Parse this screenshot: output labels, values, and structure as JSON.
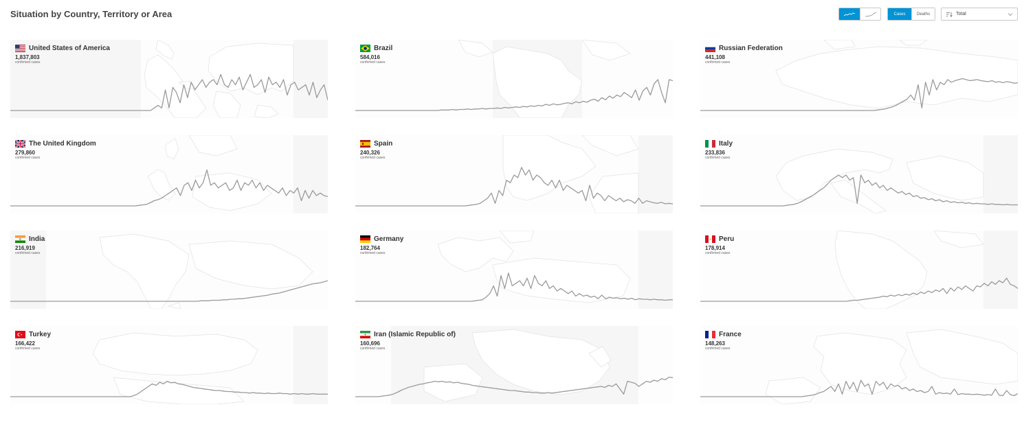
{
  "page": {
    "title": "Situation by Country, Territory or Area"
  },
  "controls": {
    "metric_tabs": [
      {
        "label": "Cases",
        "active": true
      },
      {
        "label": "Deaths",
        "active": false
      }
    ],
    "select": {
      "value": "Total"
    },
    "accent_color": "#0093d5"
  },
  "countries": [
    {
      "name": "United States of America",
      "cases": "1,837,803",
      "sub": "confirmed cases",
      "flag": "us",
      "map": "world",
      "trend": [
        0,
        0,
        0,
        0,
        0,
        0,
        0,
        0,
        0,
        0,
        0,
        0,
        0,
        0,
        0,
        0,
        0,
        0,
        0,
        0,
        0,
        0,
        0,
        0,
        0,
        0,
        0,
        0,
        0,
        0,
        0,
        0,
        0,
        0,
        0,
        0,
        0,
        0,
        0,
        0.05,
        0.1,
        0.05,
        0.4,
        0.05,
        0.45,
        0.35,
        0.15,
        0.5,
        0.25,
        0.55,
        0.4,
        0.5,
        0.6,
        0.45,
        0.55,
        0.6,
        0.5,
        0.7,
        0.5,
        0.45,
        0.6,
        0.5,
        0.65,
        0.4,
        0.55,
        0.7,
        0.45,
        0.5,
        0.6,
        0.35,
        0.65,
        0.5,
        0.55,
        0.45,
        0.6,
        0.3,
        0.5,
        0.55,
        0.4,
        0.45,
        0.5,
        0.3,
        0.55,
        0.25,
        0.4,
        0.5,
        0.2
      ]
    },
    {
      "name": "Brazil",
      "cases": "584,016",
      "sub": "confirmed cases",
      "flag": "br",
      "map": "americas",
      "trend": [
        0,
        0,
        0,
        0,
        0,
        0,
        0,
        0,
        0,
        0,
        0,
        0,
        0,
        0,
        0,
        0,
        0,
        0,
        0,
        0,
        0,
        0,
        0,
        0.01,
        0.01,
        0.01,
        0.02,
        0.01,
        0.02,
        0.02,
        0.03,
        0.02,
        0.03,
        0.03,
        0.04,
        0.03,
        0.04,
        0.04,
        0.05,
        0.04,
        0.06,
        0.05,
        0.06,
        0.07,
        0.06,
        0.08,
        0.07,
        0.09,
        0.08,
        0.1,
        0.09,
        0.12,
        0.1,
        0.13,
        0.11,
        0.12,
        0.14,
        0.15,
        0.13,
        0.17,
        0.15,
        0.18,
        0.16,
        0.2,
        0.22,
        0.18,
        0.25,
        0.21,
        0.28,
        0.24,
        0.3,
        0.27,
        0.35,
        0.3,
        0.25,
        0.4,
        0.2,
        0.38,
        0.45,
        0.3,
        0.52,
        0.6,
        0.35,
        0.15,
        0.6,
        0.58
      ]
    },
    {
      "name": "Russian Federation",
      "cases": "441,108",
      "sub": "confirmed cases",
      "flag": "ru",
      "map": "eurasia",
      "trend": [
        0,
        0,
        0,
        0,
        0,
        0,
        0,
        0,
        0,
        0,
        0,
        0,
        0,
        0,
        0,
        0,
        0,
        0,
        0,
        0,
        0,
        0,
        0,
        0,
        0,
        0,
        0,
        0,
        0,
        0,
        0,
        0,
        0,
        0,
        0,
        0,
        0,
        0,
        0,
        0,
        0,
        0,
        0,
        0,
        0,
        0,
        0,
        0,
        0.01,
        0.02,
        0.03,
        0.05,
        0.07,
        0.1,
        0.14,
        0.18,
        0.22,
        0.3,
        0.2,
        0.5,
        0.05,
        0.55,
        0.3,
        0.6,
        0.4,
        0.55,
        0.5,
        0.6,
        0.55,
        0.58,
        0.6,
        0.62,
        0.6,
        0.58,
        0.59,
        0.6,
        0.58,
        0.57,
        0.56,
        0.58,
        0.55,
        0.56,
        0.54,
        0.56,
        0.55,
        0.53,
        0.54
      ]
    },
    {
      "name": "The United Kingdom",
      "cases": "279,860",
      "sub": "confirmed cases",
      "flag": "gb",
      "map": "europe",
      "trend": [
        0,
        0,
        0,
        0,
        0,
        0,
        0,
        0,
        0,
        0,
        0,
        0,
        0,
        0,
        0,
        0,
        0,
        0,
        0,
        0,
        0,
        0,
        0,
        0,
        0,
        0,
        0,
        0,
        0,
        0,
        0,
        0,
        0,
        0,
        0.01,
        0.02,
        0.03,
        0.06,
        0.1,
        0.12,
        0.15,
        0.2,
        0.25,
        0.3,
        0.35,
        0.2,
        0.4,
        0.45,
        0.3,
        0.5,
        0.35,
        0.45,
        0.7,
        0.4,
        0.45,
        0.35,
        0.4,
        0.45,
        0.3,
        0.35,
        0.5,
        0.3,
        0.45,
        0.4,
        0.5,
        0.35,
        0.45,
        0.3,
        0.4,
        0.35,
        0.3,
        0.25,
        0.35,
        0.2,
        0.3,
        0.25,
        0.35,
        0.1,
        0.3,
        0.15,
        0.3,
        0.2,
        0.25,
        0.2,
        0.18
      ]
    },
    {
      "name": "Spain",
      "cases": "240,326",
      "sub": "confirmed cases",
      "flag": "es",
      "map": "iberia",
      "trend": [
        0,
        0,
        0,
        0,
        0,
        0,
        0,
        0,
        0,
        0,
        0,
        0,
        0,
        0,
        0,
        0,
        0,
        0,
        0,
        0,
        0,
        0,
        0,
        0,
        0,
        0,
        0,
        0,
        0,
        0,
        0.01,
        0.02,
        0.03,
        0.05,
        0.1,
        0.15,
        0.25,
        0.05,
        0.3,
        0.2,
        0.5,
        0.45,
        0.6,
        0.55,
        0.75,
        0.6,
        0.7,
        0.5,
        0.6,
        0.55,
        0.45,
        0.4,
        0.5,
        0.35,
        0.5,
        0.3,
        0.4,
        0.35,
        0.3,
        0.25,
        0.3,
        0.1,
        0.4,
        0.15,
        0.25,
        0.2,
        0.1,
        0.2,
        0.15,
        0.1,
        0.15,
        0.08,
        0.12,
        0.1,
        0.05,
        0.15,
        0.05,
        0.1,
        0.08,
        0.06,
        0.05,
        0.07,
        0.04,
        0.05,
        0.04
      ]
    },
    {
      "name": "Italy",
      "cases": "233,836",
      "sub": "confirmed cases",
      "flag": "it",
      "map": "italy",
      "trend": [
        0,
        0,
        0,
        0,
        0,
        0,
        0,
        0,
        0,
        0,
        0,
        0,
        0,
        0,
        0,
        0,
        0,
        0,
        0,
        0,
        0,
        0,
        0,
        0.01,
        0.02,
        0.03,
        0.05,
        0.08,
        0.12,
        0.16,
        0.2,
        0.25,
        0.3,
        0.35,
        0.42,
        0.5,
        0.55,
        0.6,
        0.55,
        0.6,
        0.5,
        0.55,
        0.05,
        0.6,
        0.45,
        0.5,
        0.4,
        0.45,
        0.35,
        0.4,
        0.3,
        0.35,
        0.3,
        0.25,
        0.28,
        0.22,
        0.25,
        0.18,
        0.2,
        0.15,
        0.16,
        0.12,
        0.14,
        0.1,
        0.12,
        0.08,
        0.1,
        0.07,
        0.08,
        0.06,
        0.07,
        0.05,
        0.06,
        0.04,
        0.05,
        0.04,
        0.04,
        0.03,
        0.04,
        0.03,
        0.03,
        0.02,
        0.03,
        0.02,
        0.02,
        0.02
      ]
    },
    {
      "name": "India",
      "cases": "216,919",
      "sub": "confirmed cases",
      "flag": "in",
      "map": "asia",
      "trend": [
        0,
        0,
        0,
        0,
        0,
        0,
        0,
        0,
        0,
        0,
        0,
        0,
        0,
        0,
        0,
        0,
        0,
        0,
        0,
        0,
        0,
        0,
        0,
        0,
        0,
        0,
        0,
        0,
        0,
        0,
        0,
        0,
        0,
        0,
        0,
        0,
        0,
        0,
        0,
        0,
        0,
        0,
        0,
        0,
        0,
        0,
        0,
        0,
        0,
        0,
        0,
        0.01,
        0.01,
        0.01,
        0.02,
        0.02,
        0.02,
        0.03,
        0.03,
        0.04,
        0.04,
        0.05,
        0.05,
        0.06,
        0.07,
        0.08,
        0.09,
        0.1,
        0.11,
        0.12,
        0.14,
        0.15,
        0.16,
        0.18,
        0.2,
        0.22,
        0.24,
        0.26,
        0.28,
        0.3,
        0.32,
        0.34,
        0.35,
        0.36,
        0.38,
        0.4
      ]
    },
    {
      "name": "Germany",
      "cases": "182,764",
      "sub": "confirmed cases",
      "flag": "de",
      "map": "central",
      "trend": [
        0,
        0,
        0,
        0,
        0,
        0,
        0,
        0,
        0,
        0,
        0,
        0,
        0,
        0,
        0,
        0,
        0,
        0,
        0,
        0,
        0,
        0,
        0,
        0,
        0,
        0,
        0,
        0,
        0,
        0,
        0,
        0,
        0.01,
        0.02,
        0.03,
        0.08,
        0.15,
        0.3,
        0.1,
        0.5,
        0.25,
        0.55,
        0.3,
        0.35,
        0.4,
        0.3,
        0.45,
        0.25,
        0.5,
        0.35,
        0.3,
        0.4,
        0.25,
        0.3,
        0.2,
        0.25,
        0.2,
        0.15,
        0.2,
        0.1,
        0.15,
        0.1,
        0.12,
        0.08,
        0.1,
        0.05,
        0.12,
        0.05,
        0.08,
        0.06,
        0.07,
        0.05,
        0.06,
        0.04,
        0.06,
        0.03,
        0.05,
        0.04,
        0.04,
        0.03,
        0.04,
        0.03,
        0.03,
        0.02,
        0.03,
        0.03
      ]
    },
    {
      "name": "Peru",
      "cases": "178,914",
      "sub": "confirmed cases",
      "flag": "pe",
      "map": "andes",
      "trend": [
        0,
        0,
        0,
        0,
        0,
        0,
        0,
        0,
        0,
        0,
        0,
        0,
        0,
        0,
        0,
        0,
        0,
        0,
        0,
        0,
        0,
        0,
        0,
        0,
        0,
        0,
        0,
        0,
        0,
        0,
        0,
        0,
        0,
        0,
        0,
        0,
        0,
        0,
        0,
        0,
        0.01,
        0.02,
        0.02,
        0.03,
        0.04,
        0.05,
        0.06,
        0.07,
        0.08,
        0.1,
        0.09,
        0.12,
        0.1,
        0.13,
        0.11,
        0.14,
        0.12,
        0.16,
        0.13,
        0.18,
        0.15,
        0.2,
        0.17,
        0.22,
        0.19,
        0.25,
        0.15,
        0.26,
        0.2,
        0.28,
        0.23,
        0.3,
        0.25,
        0.2,
        0.3,
        0.28,
        0.35,
        0.3,
        0.38,
        0.33,
        0.4,
        0.36,
        0.45,
        0.33,
        0.3,
        0.25
      ]
    },
    {
      "name": "Turkey",
      "cases": "166,422",
      "sub": "confirmed cases",
      "flag": "tr",
      "map": "anatolia",
      "trend": [
        0,
        0,
        0,
        0,
        0,
        0,
        0,
        0,
        0,
        0,
        0,
        0,
        0,
        0,
        0,
        0,
        0,
        0,
        0,
        0,
        0,
        0,
        0,
        0,
        0,
        0,
        0,
        0,
        0,
        0,
        0,
        0,
        0,
        0.02,
        0.05,
        0.1,
        0.15,
        0.2,
        0.25,
        0.22,
        0.28,
        0.25,
        0.3,
        0.27,
        0.28,
        0.25,
        0.24,
        0.22,
        0.2,
        0.18,
        0.17,
        0.16,
        0.15,
        0.14,
        0.13,
        0.12,
        0.12,
        0.11,
        0.1,
        0.1,
        0.09,
        0.09,
        0.08,
        0.08,
        0.07,
        0.08,
        0.07,
        0.07,
        0.06,
        0.07,
        0.06,
        0.06,
        0.07,
        0.06,
        0.06,
        0.05,
        0.06,
        0.05,
        0.06,
        0.05,
        0.05,
        0.06,
        0.05,
        0.05,
        0.05,
        0.05
      ]
    },
    {
      "name": "Iran (Islamic Republic of)",
      "cases": "160,696",
      "sub": "confirmed cases",
      "flag": "ir",
      "map": "persia",
      "trend": [
        0,
        0,
        0,
        0,
        0,
        0,
        0,
        0.01,
        0.02,
        0.03,
        0.05,
        0.08,
        0.12,
        0.15,
        0.18,
        0.2,
        0.22,
        0.24,
        0.25,
        0.27,
        0.28,
        0.3,
        0.29,
        0.3,
        0.28,
        0.29,
        0.27,
        0.28,
        0.26,
        0.25,
        0.24,
        0.22,
        0.21,
        0.2,
        0.19,
        0.18,
        0.17,
        0.16,
        0.15,
        0.14,
        0.13,
        0.12,
        0.12,
        0.11,
        0.1,
        0.09,
        0.09,
        0.08,
        0.08,
        0.07,
        0.07,
        0.08,
        0.07,
        0.08,
        0.09,
        0.1,
        0.11,
        0.12,
        0.13,
        0.14,
        0.15,
        0.16,
        0.17,
        0.18,
        0.19,
        0.2,
        0.18,
        0.22,
        0.2,
        0.25,
        0.15,
        0.05,
        0.3,
        0.28,
        0.26,
        0.2,
        0.25,
        0.3,
        0.28,
        0.32,
        0.3,
        0.35,
        0.33,
        0.38,
        0.37
      ]
    },
    {
      "name": "France",
      "cases": "148,263",
      "sub": "confirmed cases",
      "flag": "fr",
      "map": "gaul",
      "trend": [
        0,
        0,
        0,
        0,
        0,
        0,
        0,
        0,
        0,
        0,
        0,
        0,
        0,
        0,
        0,
        0,
        0,
        0,
        0,
        0,
        0,
        0,
        0,
        0,
        0,
        0,
        0,
        0,
        0.01,
        0.02,
        0.03,
        0.05,
        0.08,
        0.1,
        0.15,
        0.2,
        0.1,
        0.25,
        0.05,
        0.3,
        0.15,
        0.28,
        0.1,
        0.32,
        0.2,
        0.25,
        0.05,
        0.3,
        0.22,
        0.28,
        0.15,
        0.25,
        0.2,
        0.22,
        0.15,
        0.18,
        0.12,
        0.15,
        0.1,
        0.12,
        0.08,
        0.1,
        0.2,
        0.05,
        0.08,
        0.06,
        0.07,
        0.05,
        0.15,
        0.04,
        0.06,
        0.05,
        0.05,
        0.04,
        0.05,
        0.04,
        0.03,
        0.04,
        0.03,
        0.15,
        0.03,
        0.02,
        0.12,
        0.04,
        0.02,
        0.06
      ]
    }
  ]
}
